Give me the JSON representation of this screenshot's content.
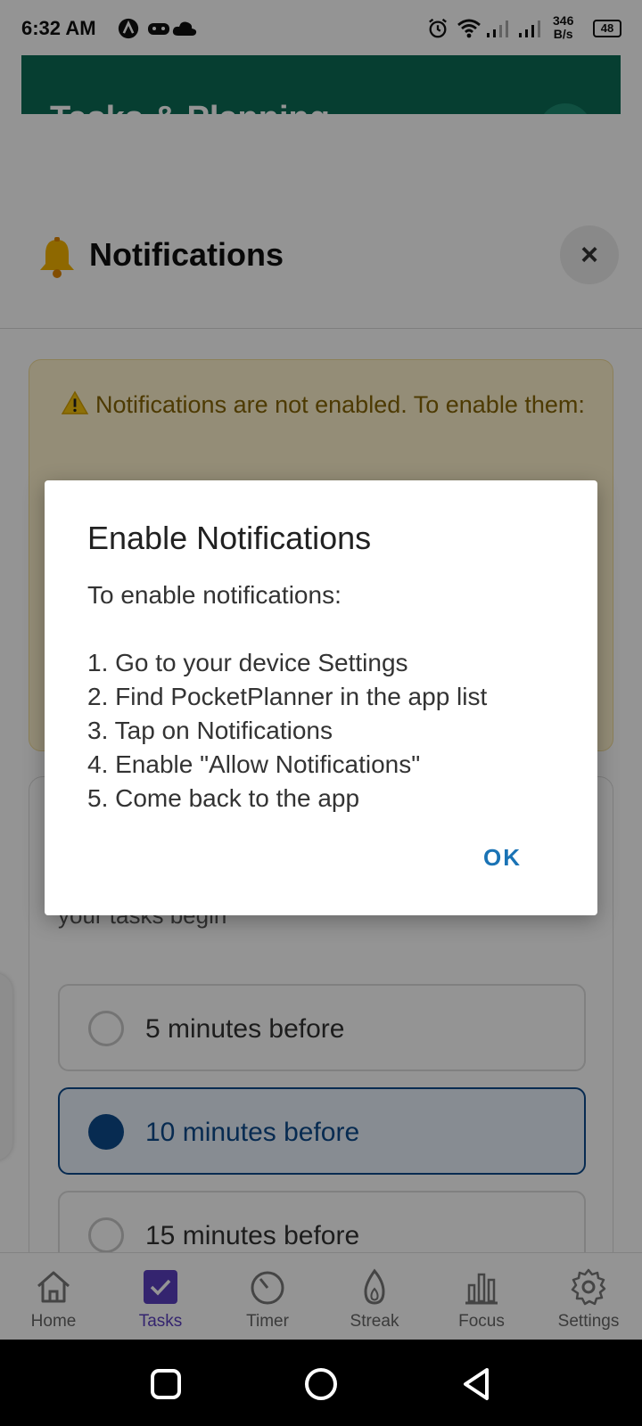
{
  "status_bar": {
    "time": "6:32 AM",
    "speed_value": "346",
    "speed_unit": "B/s",
    "battery": "48",
    "icons": [
      "nav-arrow-icon",
      "gamepad-icon",
      "cloud-icon",
      "alarm-icon",
      "wifi-icon",
      "signal-icon",
      "signal-icon"
    ]
  },
  "app_header": {
    "title": "Tasks & Planning",
    "background": "#0b6b55"
  },
  "sheet": {
    "title": "Notifications",
    "bell_icon": "bell-icon",
    "close_label": "×",
    "warning": {
      "text": "Notifications are not enabled. To enable them:",
      "icon": "warning-icon"
    },
    "reminder_subtitle": "your tasks begin",
    "options": [
      {
        "label": "5 minutes before",
        "selected": false
      },
      {
        "label": "10 minutes before",
        "selected": true
      },
      {
        "label": "15 minutes before",
        "selected": false
      }
    ]
  },
  "dialog": {
    "title": "Enable Notifications",
    "intro": "To enable notifications:",
    "steps": [
      "1. Go to your device Settings",
      "2. Find PocketPlanner in the app list",
      "3. Tap on Notifications",
      "4. Enable \"Allow Notifications\"",
      "5. Come back to the app"
    ],
    "ok_label": "OK"
  },
  "bottom_nav": {
    "items": [
      {
        "label": "Home",
        "icon": "home-icon"
      },
      {
        "label": "Tasks",
        "icon": "checkbox-icon",
        "active": true
      },
      {
        "label": "Timer",
        "icon": "timer-icon"
      },
      {
        "label": "Streak",
        "icon": "flame-icon"
      },
      {
        "label": "Focus",
        "icon": "bar-chart-icon"
      },
      {
        "label": "Settings",
        "icon": "gear-icon"
      }
    ],
    "accent": "#5b3fbf"
  },
  "colors": {
    "dialog_button": "#1a73b5",
    "selected_option": "#0d4a8c",
    "warning_background": "#fff3cd",
    "warning_text": "#856404"
  }
}
